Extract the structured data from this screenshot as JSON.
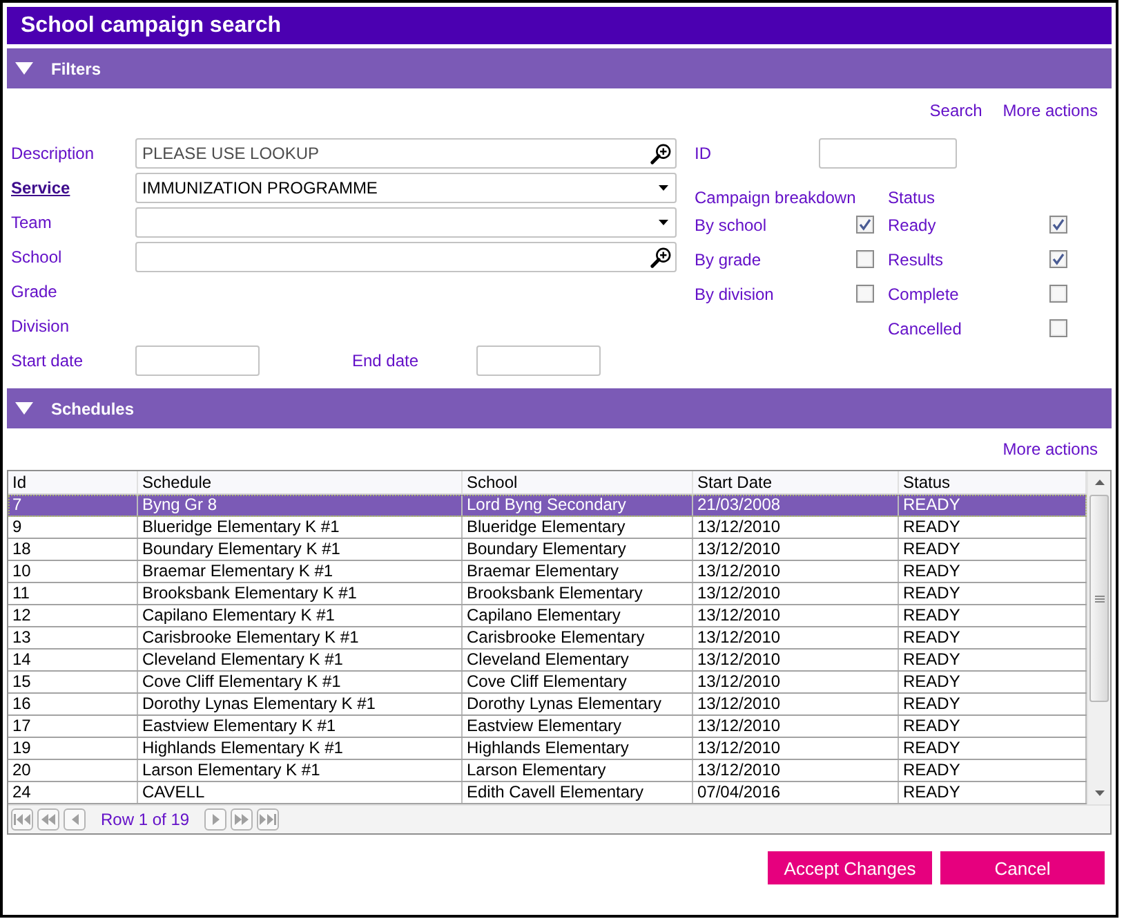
{
  "window": {
    "title": "School campaign search"
  },
  "filters": {
    "title": "Filters",
    "expanded": true,
    "actions": [
      {
        "label": "Search"
      },
      {
        "label": "More actions"
      }
    ],
    "fields": [
      {
        "kind": "lookup",
        "label": "Description",
        "required": false,
        "placeholder": "PLEASE USE LOOKUP"
      },
      {
        "kind": "dropdown",
        "label": "Service",
        "required": true,
        "value": "IMMUNIZATION PROGRAMME"
      },
      {
        "kind": "dropdown",
        "label": "Team",
        "required": false
      },
      {
        "kind": "lookup",
        "label": "School",
        "required": false
      },
      {
        "kind": "label",
        "label": "Grade",
        "required": false
      },
      {
        "kind": "label",
        "label": "Division",
        "required": false
      }
    ],
    "dates": [
      {
        "label": "Start date"
      },
      {
        "label": "End date"
      }
    ],
    "id_field": {
      "label": "ID"
    },
    "option_groups": [
      {
        "title": "Campaign breakdown",
        "options": [
          {
            "label": "By school",
            "checked": true
          },
          {
            "label": "By grade",
            "checked": false
          },
          {
            "label": "By division",
            "checked": false
          }
        ]
      },
      {
        "title": "Status",
        "options": [
          {
            "label": "Ready",
            "checked": true
          },
          {
            "label": "Results",
            "checked": true
          },
          {
            "label": "Complete",
            "checked": false
          },
          {
            "label": "Cancelled",
            "checked": false
          }
        ]
      }
    ]
  },
  "schedules": {
    "title": "Schedules",
    "expanded": true,
    "actions": [
      {
        "label": "More actions"
      }
    ],
    "table": {
      "columns": [
        "Id",
        "Schedule",
        "School",
        "Start Date",
        "Status"
      ],
      "rows": [
        {
          "selected": true,
          "cells": [
            "7",
            "Byng Gr 8",
            "Lord Byng Secondary",
            "21/03/2008",
            "READY"
          ]
        },
        {
          "selected": false,
          "cells": [
            "9",
            "Blueridge Elementary K #1",
            "Blueridge Elementary",
            "13/12/2010",
            "READY"
          ]
        },
        {
          "selected": false,
          "cells": [
            "18",
            "Boundary Elementary K #1",
            "Boundary Elementary",
            "13/12/2010",
            "READY"
          ]
        },
        {
          "selected": false,
          "cells": [
            "10",
            "Braemar Elementary K #1",
            "Braemar Elementary",
            "13/12/2010",
            "READY"
          ]
        },
        {
          "selected": false,
          "cells": [
            "11",
            "Brooksbank Elementary K #1",
            "Brooksbank Elementary",
            "13/12/2010",
            "READY"
          ]
        },
        {
          "selected": false,
          "cells": [
            "12",
            "Capilano Elementary K #1",
            "Capilano Elementary",
            "13/12/2010",
            "READY"
          ]
        },
        {
          "selected": false,
          "cells": [
            "13",
            "Carisbrooke Elementary K #1",
            "Carisbrooke Elementary",
            "13/12/2010",
            "READY"
          ]
        },
        {
          "selected": false,
          "cells": [
            "14",
            "Cleveland Elementary K #1",
            "Cleveland Elementary",
            "13/12/2010",
            "READY"
          ]
        },
        {
          "selected": false,
          "cells": [
            "15",
            "Cove Cliff Elementary K #1",
            "Cove Cliff Elementary",
            "13/12/2010",
            "READY"
          ]
        },
        {
          "selected": false,
          "cells": [
            "16",
            "Dorothy Lynas Elementary K #1",
            "Dorothy Lynas Elementary",
            "13/12/2010",
            "READY"
          ]
        },
        {
          "selected": false,
          "cells": [
            "17",
            "Eastview Elementary K #1",
            "Eastview Elementary",
            "13/12/2010",
            "READY"
          ]
        },
        {
          "selected": false,
          "cells": [
            "19",
            "Highlands Elementary K #1",
            "Highlands Elementary",
            "13/12/2010",
            "READY"
          ]
        },
        {
          "selected": false,
          "cells": [
            "20",
            "Larson Elementary K #1",
            "Larson Elementary",
            "13/12/2010",
            "READY"
          ]
        },
        {
          "selected": false,
          "cells": [
            "24",
            "CAVELL",
            "Edith Cavell Elementary",
            "07/04/2016",
            "READY"
          ]
        }
      ]
    },
    "pager": {
      "label": "Row 1 of 19"
    }
  },
  "buttons": [
    {
      "label": "Accept Changes"
    },
    {
      "label": "Cancel"
    }
  ]
}
